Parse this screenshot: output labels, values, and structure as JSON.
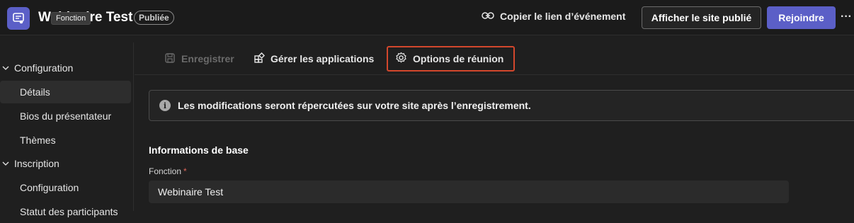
{
  "header": {
    "title": "Webinaire Test",
    "tooltip": "Fonction",
    "status_badge": "Publiée",
    "copy_link_label": "Copier le lien d’événement",
    "view_site_label": "Afficher le site publié",
    "join_label": "Rejoindre",
    "more_label": "···",
    "accent_color": "#5b5fc7"
  },
  "sidebar": {
    "groups": [
      {
        "label": "Configuration",
        "items": [
          "Détails",
          "Bios du présentateur",
          "Thèmes"
        ]
      },
      {
        "label": "Inscription",
        "items": [
          "Configuration",
          "Statut des participants"
        ]
      }
    ],
    "selected_item": "Détails"
  },
  "toolbar": {
    "save_label": "Enregistrer",
    "manage_apps_label": "Gérer les applications",
    "meeting_options_label": "Options de réunion",
    "highlight_color": "#d3472c"
  },
  "info_banner": {
    "text": "Les modifications seront répercutées sur votre site après l’enregistrement."
  },
  "form": {
    "section_title": "Informations de base",
    "title_field": {
      "label": "Fonction",
      "required_mark": "*",
      "value": "Webinaire Test"
    }
  }
}
